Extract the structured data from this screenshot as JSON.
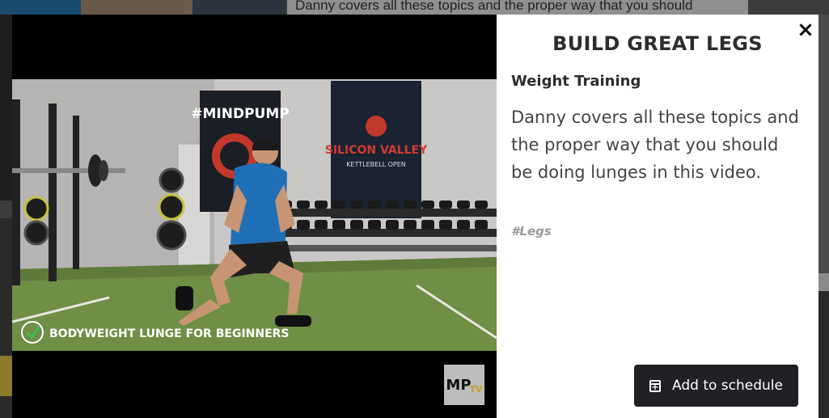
{
  "background": {
    "card_text": "Danny covers all these topics and the proper way that you should"
  },
  "modal": {
    "close_icon": "×",
    "title": "BUILD GREAT LEGS",
    "category": "Weight Training",
    "description": "Danny covers all these topics and the proper way that you should be doing lunges in this video.",
    "tag": "#Legs",
    "schedule_button": "Add to schedule"
  },
  "video": {
    "banner_left": "#MINDPUMP",
    "banner_right_title": "SILICON VALLEY",
    "banner_right_sub": "KETTLEBELL OPEN",
    "caption": "BODYWEIGHT LUNGE FOR BEGINNERS",
    "watermark": "MP",
    "watermark_sub": "TV"
  }
}
